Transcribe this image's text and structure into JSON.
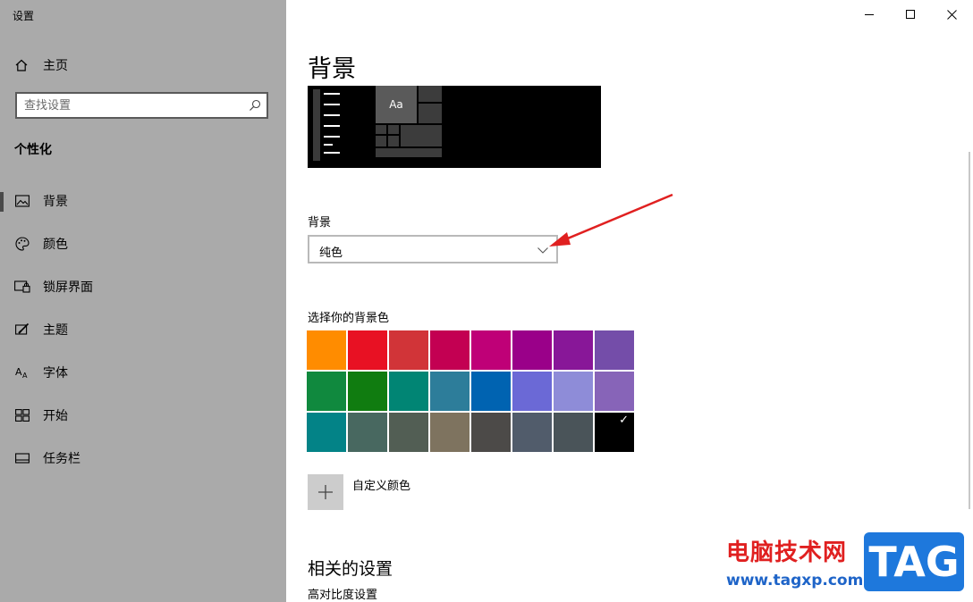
{
  "window": {
    "title": "设置"
  },
  "sidebar": {
    "home_label": "主页",
    "search_placeholder": "查找设置",
    "section_title": "个性化",
    "items": [
      {
        "label": "背景",
        "icon": "picture-icon",
        "active": true
      },
      {
        "label": "颜色",
        "icon": "palette-icon",
        "active": false
      },
      {
        "label": "锁屏界面",
        "icon": "lockscreen-icon",
        "active": false
      },
      {
        "label": "主题",
        "icon": "theme-brush-icon",
        "active": false
      },
      {
        "label": "字体",
        "icon": "font-icon",
        "active": false
      },
      {
        "label": "开始",
        "icon": "start-grid-icon",
        "active": false
      },
      {
        "label": "任务栏",
        "icon": "taskbar-icon",
        "active": false
      }
    ]
  },
  "main": {
    "page_title": "背景",
    "preview": {
      "sample_text": "Aa"
    },
    "background_label": "背景",
    "background_value": "纯色",
    "color_picker_label": "选择你的背景色",
    "colors": [
      "#ff8c00",
      "#e81123",
      "#d13438",
      "#c30052",
      "#bf0077",
      "#9a0089",
      "#881798",
      "#744da9",
      "#10893e",
      "#107c10",
      "#018574",
      "#2d7d9a",
      "#0063b1",
      "#6b69d6",
      "#8e8cd8",
      "#8764b8",
      "#038387",
      "#486860",
      "#525e54",
      "#7e735f",
      "#4c4a48",
      "#515c6b",
      "#4a5459",
      "#000000"
    ],
    "selected_color_index": 23,
    "custom_color_label": "自定义颜色",
    "related_title": "相关的设置",
    "related_link": "高对比度设置"
  },
  "watermark": {
    "site_name": "电脑技术网",
    "site_url": "www.tagxp.com",
    "logo_text": "TAG"
  },
  "colors": {
    "sidebar_bg": "#aaaaaa",
    "annotation_arrow": "#e02020"
  }
}
